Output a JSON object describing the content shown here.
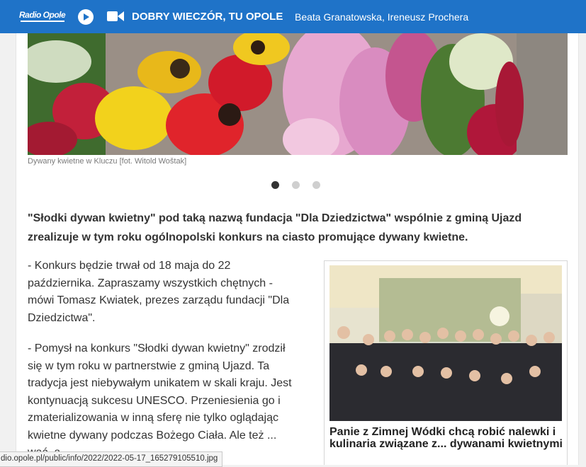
{
  "player": {
    "logo_text": "Radio Opole",
    "show_title": "DOBRY WIECZÓR, TU OPOLE",
    "hosts": "Beata Granatowska, Ireneusz Prochera"
  },
  "gallery": {
    "caption": "Dywany kwietne w Kluczu [fot. Witold Woštak]",
    "slides": 3,
    "active_slide": 1
  },
  "article": {
    "lead": "\"Słodki dywan kwietny\" pod taką nazwą fundacja \"Dla Dziedzictwa\" wspólnie z gminą Ujazd zrealizuje w tym roku ogólnopolski konkurs na ciasto promujące dywany kwietne.",
    "paragraphs": [
      "- Konkurs będzie trwał od 18 maja do 22 października. Zapraszamy wszystkich chętnych - mówi Tomasz Kwiatek, prezes zarządu fundacji \"Dla Dziedzictwa\".",
      "- Pomysł na konkurs \"Słodki dywan kwietny\" zrodził się w tym roku w partnerstwie z gminą Ujazd. Ta tradycja jest niebywałym unikatem w skali kraju. Jest kontynuacją sukcesu UNESCO. Przeniesienia go i zmaterializowania w inną sferę nie tylko oglądając kwietne dywany podczas Bożego Ciała. Ale też ... wać, a"
    ]
  },
  "related": {
    "title": "Panie z Zimnej Wódki chcą robić nalewki i kulinaria związane z... dywanami kwietnymi"
  },
  "status_bar": {
    "url": "dio.opole.pl/public/info/2022/2022-05-17_165279105510.jpg"
  },
  "colors": {
    "accent": "#1f73c8"
  }
}
